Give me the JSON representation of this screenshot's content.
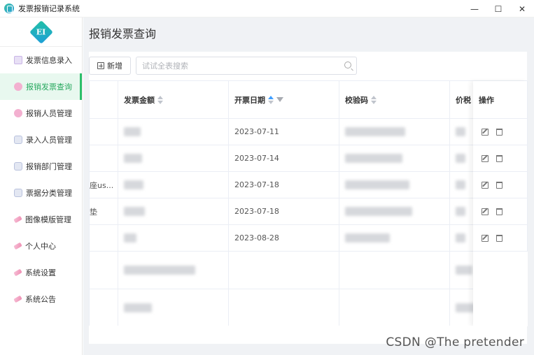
{
  "window": {
    "title": "发票报销记录系统",
    "minimize": "—",
    "maximize": "☐",
    "close": "✕"
  },
  "sidebar": {
    "logo_text": "EI",
    "items": [
      {
        "label": "发票信息录入",
        "icon": "pinwheel-icon"
      },
      {
        "label": "报销发票查询",
        "icon": "flower-icon",
        "active": true
      },
      {
        "label": "报销人员管理",
        "icon": "flower-icon"
      },
      {
        "label": "录入人员管理",
        "icon": "camera-icon"
      },
      {
        "label": "报销部门管理",
        "icon": "camera-icon"
      },
      {
        "label": "票据分类管理",
        "icon": "camera-icon"
      },
      {
        "label": "图像模版管理",
        "icon": "brush-icon"
      },
      {
        "label": "个人中心",
        "icon": "brush-icon"
      },
      {
        "label": "系统设置",
        "icon": "brush-icon"
      },
      {
        "label": "系统公告",
        "icon": "brush-icon"
      }
    ]
  },
  "main": {
    "page_title": "报销发票查询",
    "toolbar": {
      "add_label": "新增",
      "search_placeholder": "试试全表搜索"
    },
    "table": {
      "columns": [
        "发票金额",
        "开票日期",
        "校验码",
        "价税",
        "操作"
      ],
      "rows": [
        {
          "col0": "",
          "date": "2023-07-11"
        },
        {
          "col0": "",
          "date": "2023-07-14"
        },
        {
          "col0": "座us...",
          "date": "2023-07-18"
        },
        {
          "col0": "垫",
          "date": "2023-07-18"
        },
        {
          "col0": "",
          "date": "2023-08-28"
        },
        {
          "col0": "",
          "date": ""
        },
        {
          "col0": "",
          "date": ""
        }
      ]
    }
  },
  "watermark": "CSDN @The  pretender",
  "colors": {
    "accent": "#2cbf6b",
    "active_bg": "#e8f8ef",
    "sort_active": "#409eff"
  }
}
